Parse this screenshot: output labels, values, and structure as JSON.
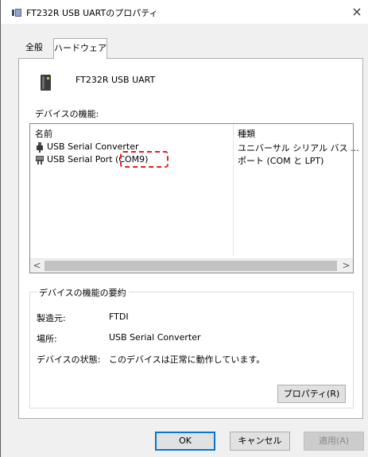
{
  "window": {
    "title": "FT232R USB UARTのプロパティ",
    "close_glyph": "×"
  },
  "tabs": [
    {
      "label": "全般",
      "selected": false
    },
    {
      "label": "ハードウェア",
      "selected": true
    }
  ],
  "device": {
    "name": "FT232R USB UART",
    "icon": "usb-device-icon"
  },
  "functions": {
    "label": "デバイスの機能:",
    "columns": {
      "name": "名前",
      "type": "種類"
    },
    "rows": [
      {
        "name": "USB Serial Converter",
        "type": "ユニバーサル シリアル バス ...",
        "icon": "usb-plug-icon"
      },
      {
        "name": "USB Serial Port (COM9)",
        "type": "ポート (COM と LPT)",
        "icon": "port-icon"
      }
    ],
    "annotation": "COM9"
  },
  "scroll": {
    "left_glyph": "<",
    "right_glyph": ">"
  },
  "summary": {
    "legend": "デバイスの機能の要約",
    "manufacturer_label": "製造元:",
    "manufacturer_value": "FTDI",
    "location_label": "場所:",
    "location_value": "USB Serial Converter",
    "status_label": "デバイスの状態:",
    "status_value": "このデバイスは正常に動作しています。",
    "properties_button": "プロパティ(R)"
  },
  "buttons": {
    "ok": "OK",
    "cancel": "キャンセル",
    "apply": "適用(A)"
  },
  "colors": {
    "highlight": "#e02020",
    "ok_border": "#0078d7"
  }
}
